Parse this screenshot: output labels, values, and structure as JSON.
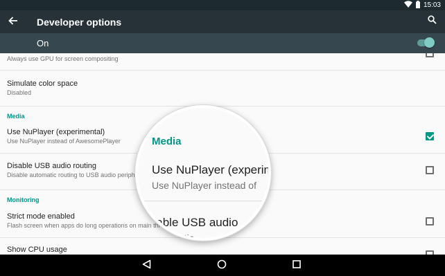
{
  "status_bar": {
    "time": "15:03"
  },
  "app_bar": {
    "title": "Developer options"
  },
  "master_switch": {
    "label": "On",
    "checked": true
  },
  "list": {
    "gpu_row": {
      "summary": "Always use GPU for screen compositing",
      "checked": false
    },
    "color_space_row": {
      "title": "Simulate color space",
      "summary": "Disabled"
    },
    "media_header": "Media",
    "nuplayer_row": {
      "title": "Use NuPlayer (experimental)",
      "summary": "Use NuPlayer instead of AwesomePlayer",
      "checked": true
    },
    "usb_audio_row": {
      "title": "Disable USB audio routing",
      "summary": "Disable automatic routing to USB audio peripherals",
      "checked": false
    },
    "monitoring_header": "Monitoring",
    "strict_mode_row": {
      "title": "Strict mode enabled",
      "summary": "Flash screen when apps do long operations on main thread",
      "checked": false
    },
    "cpu_usage_row": {
      "title": "Show CPU usage",
      "checked": false
    }
  },
  "magnifier": {
    "category": "Media",
    "line1": "Use NuPlayer (experim",
    "line2": "Use NuPlayer instead of",
    "line3": "isable USB audio",
    "line4": "  automatic"
  },
  "colors": {
    "accent": "#009688",
    "app_bar": "#263238",
    "switch_bar": "#37474f"
  },
  "icons": [
    "wifi-icon",
    "battery-icon",
    "back-arrow-icon",
    "search-icon",
    "nav-back-icon",
    "nav-home-icon",
    "nav-recents-icon"
  ]
}
